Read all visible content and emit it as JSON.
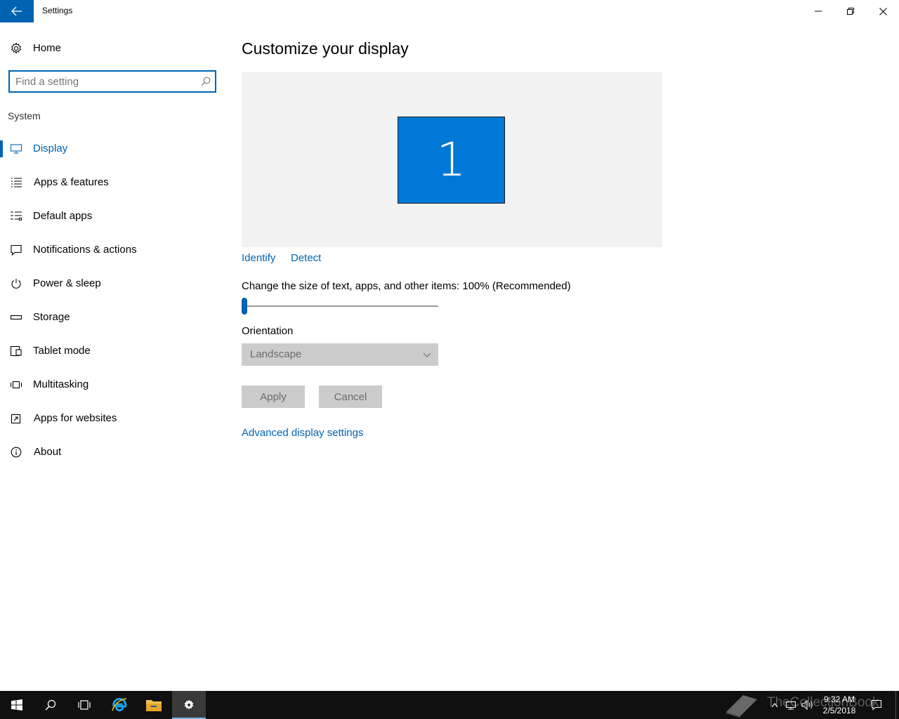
{
  "window": {
    "title": "Settings",
    "back_icon": "arrow-left-icon",
    "minimize_icon": "minimize-icon",
    "restore_icon": "restore-icon",
    "close_icon": "close-icon"
  },
  "sidebar": {
    "home": {
      "label": "Home",
      "icon": "gear-icon"
    },
    "search": {
      "placeholder": "Find a setting",
      "value": "",
      "icon": "search-icon"
    },
    "section": "System",
    "items": [
      {
        "label": "Display",
        "icon": "monitor-icon",
        "active": true
      },
      {
        "label": "Apps & features",
        "icon": "list-icon"
      },
      {
        "label": "Default apps",
        "icon": "default-apps-icon"
      },
      {
        "label": "Notifications & actions",
        "icon": "notification-icon"
      },
      {
        "label": "Power & sleep",
        "icon": "power-icon"
      },
      {
        "label": "Storage",
        "icon": "storage-icon"
      },
      {
        "label": "Tablet mode",
        "icon": "tablet-icon"
      },
      {
        "label": "Multitasking",
        "icon": "multitasking-icon"
      },
      {
        "label": "Apps for websites",
        "icon": "apps-websites-icon"
      },
      {
        "label": "About",
        "icon": "info-icon"
      }
    ]
  },
  "main": {
    "title": "Customize your display",
    "monitor_number": "1",
    "identify": "Identify",
    "detect": "Detect",
    "scale_label": "Change the size of text, apps, and other items: 100% (Recommended)",
    "scale_slider_fraction": 0.0,
    "orientation_label": "Orientation",
    "orientation_value": "Landscape",
    "apply": "Apply",
    "cancel": "Cancel",
    "advanced_link": "Advanced display settings"
  },
  "taskbar": {
    "items": [
      "windows-start-icon",
      "search-icon",
      "task-view-icon",
      "internet-explorer-icon",
      "file-explorer-icon",
      "settings-gear-icon"
    ],
    "active_item": "settings-gear-icon",
    "time": "9:32 AM",
    "date": "2/5/2018",
    "watermark": "TheCollectionBook"
  },
  "colors": {
    "accent": "#0063b1",
    "monitor_fill": "#0078d7",
    "display_area_bg": "#f2f2f2",
    "disabled_bg": "#cccccc",
    "taskbar_bg": "#101010"
  }
}
